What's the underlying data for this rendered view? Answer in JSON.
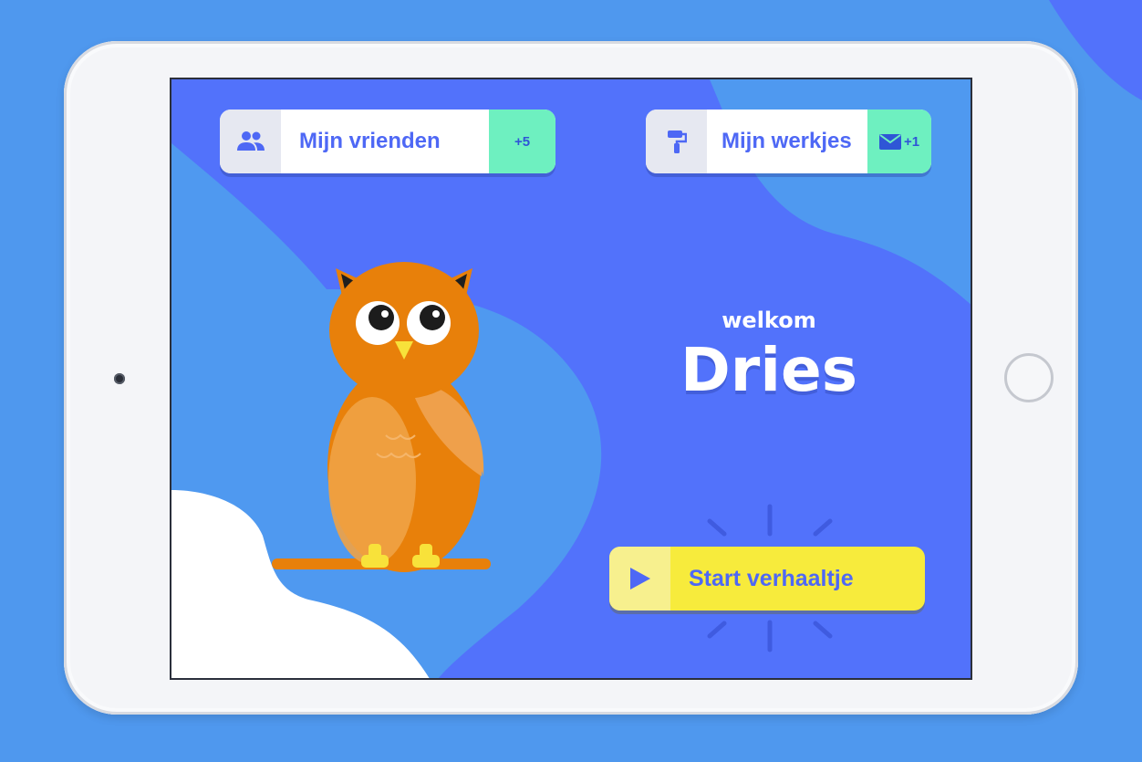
{
  "header": {
    "friends_label": "Mijn vrienden",
    "friends_badge": "+5",
    "works_label": "Mijn werkjes",
    "works_badge": "+1"
  },
  "welcome": {
    "greeting": "welkom",
    "name": "Dries"
  },
  "start_button": {
    "label": "Start verhaaltje"
  },
  "icons": {
    "friends": "people-icon",
    "works": "paint-roller-icon",
    "message": "envelope-icon",
    "start": "play-icon"
  },
  "colors": {
    "page_bg": "#4f98ee",
    "screen_bg": "#5272fb",
    "wave": "#4f99f0",
    "badge": "#6ef0c0",
    "start_button": "#f7eb3c",
    "owl": "#e8800a"
  }
}
